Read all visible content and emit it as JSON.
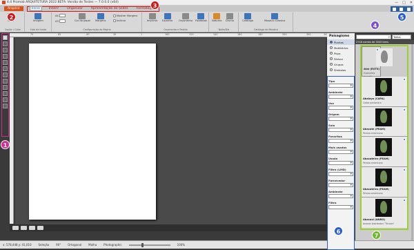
{
  "window": {
    "title": "4.4 Promob ARQUITETURA 2022 BETA: Versão de Testes — 7.0.0.0 (x64)",
    "controls": [
      "—",
      "□",
      "✕"
    ]
  },
  "menubar": {
    "file": "Arquivo",
    "tabs": [
      {
        "label": "Início",
        "active": true
      },
      {
        "label": "Inserir",
        "active": false
      },
      {
        "label": "Organizar",
        "active": false
      },
      {
        "label": "Apresentação de Slides",
        "active": false
      },
      {
        "label": "Formatação",
        "active": false
      }
    ]
  },
  "ribbon": {
    "groups": [
      {
        "label": "Copiar / Colar"
      },
      {
        "label": "Foto de fundo"
      },
      {
        "label": "Configuração da Página"
      },
      {
        "label": "Orçamento e Pedido"
      },
      {
        "label": "Noite/Dia"
      },
      {
        "label": "Catálogo de Mosaico"
      }
    ],
    "buttons": [
      {
        "label": "Colar",
        "icon": "clipboard-icon"
      },
      {
        "label": "Imagem",
        "icon": "image-icon"
      },
      {
        "label": "Cor do papel",
        "icon": "paper-color-icon"
      },
      {
        "label": "Margens",
        "icon": "margins-icon"
      },
      {
        "label": "Mostrar Margens",
        "icon": "checkbox-icon"
      },
      {
        "label": "Inclinar",
        "icon": "tilt-icon"
      },
      {
        "label": "Imprimir",
        "icon": "printer-icon"
      },
      {
        "label": "Exportar",
        "icon": "export-icon"
      },
      {
        "label": "Orçamento",
        "icon": "budget-icon"
      },
      {
        "label": "Facebook",
        "icon": "facebook-icon"
      },
      {
        "label": "Noturno",
        "icon": "night-icon"
      },
      {
        "label": "Diurno",
        "icon": "day-icon"
      },
      {
        "label": "Catálogo",
        "icon": "catalog-icon"
      },
      {
        "label": "Mosaico Clássico",
        "icon": "mosaic-icon"
      }
    ],
    "size_labels": [
      "A4",
      "A3"
    ],
    "page_size": "21 x 29,7"
  },
  "badges": [
    "1",
    "2",
    "3",
    "4",
    "5",
    "6",
    "7"
  ],
  "ruler": {
    "ticks": [
      "70",
      "65",
      "-40",
      "35",
      "1",
      "160",
      "120",
      "140",
      "160",
      "180",
      "200",
      "300",
      "345"
    ]
  },
  "left_tools": {
    "count": 12
  },
  "status": {
    "coords": "x: 578,448  y: 41,010",
    "mode": "Seleção",
    "angle": "90°",
    "ortho": "Ortogonal",
    "snap": "Malha",
    "layer": "Photographic",
    "zoom": "100%"
  },
  "panel": {
    "title": "Paisagismo",
    "categories": [
      {
        "label": "Plantas",
        "checked": true
      },
      {
        "label": "Mobiliários",
        "checked": false
      },
      {
        "label": "Pisos",
        "checked": false
      },
      {
        "label": "Divisor",
        "checked": false
      },
      {
        "label": "Grupos",
        "checked": false
      },
      {
        "label": "Símbolos",
        "checked": false
      }
    ],
    "filters": [
      "Tipo",
      "Ambiente",
      "Uso",
      "Origem",
      "Solo",
      "Favoritos",
      "Mais usados",
      "Usado recentemente",
      "Filtro (LMD)",
      "Fornecedor",
      "Ambiente",
      "Filtro"
    ]
  },
  "results": {
    "search_placeholder": "",
    "scope": "Todos",
    "count": "2718 nomes de 3043 itens",
    "items": [
      {
        "name": "Ataí (EUT0)",
        "sci": "Euphorbia tirucalli",
        "selected": true
      },
      {
        "name": "Abalaya (CAPA)",
        "sci": "Ceiba pentandra",
        "selected": false
      },
      {
        "name": "Abacate (PEAM)",
        "sci": "Persea americana",
        "selected": false
      },
      {
        "name": "Abacateiro (PEAM)",
        "sci": "Persea americana",
        "selected": false
      },
      {
        "name": "Abacateiro (PEAM)",
        "sci": "Persea americana",
        "selected": false
      },
      {
        "name": "Abacaxi (ANRO)",
        "sci": "Ananas bracteatus \"Tricolor\"",
        "selected": false
      }
    ]
  },
  "colors": {
    "brand_red": "#d01818",
    "orange": "#d9541c",
    "blue": "#2a5bd7",
    "green": "#9ccf30",
    "pink": "#d12d8f"
  }
}
